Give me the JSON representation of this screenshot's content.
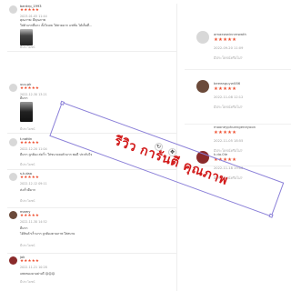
{
  "left_reviews": [
    {
      "user": "bankrp_1993",
      "stars": "★★★★★",
      "date": "2023-01-05 11:44",
      "lines": [
        "คุณภาพ: ดีคุณภาพ",
        "ใส่ตัวแรกที่แกะ ตั้งใจเลย ใส่สวยมาก แฟชั่น ได้เต็มที่..."
      ],
      "like": "มีประโยชน์"
    },
    {
      "user": "uuu.pk",
      "stars": "★★★★★",
      "date": "2022-12-30 13:21",
      "lines": [
        "ดีมาก"
      ],
      "like": "มีประโยชน์"
    },
    {
      "user": "t.nattin",
      "stars": "★★★★★",
      "date": "2022-12-20 11:04",
      "lines": [
        "ดีมาก ถูกต้อง ส่งเร็ว ใส่ขนาดลงตัวมาก พอดี ประทับใจ"
      ],
      "like": "มีประโยชน์"
    },
    {
      "user": "s.k.daa",
      "stars": "★★★★★",
      "date": "2022-12-12 09:11",
      "lines": [
        "ส่งเร็วดีมาก"
      ],
      "like": "มีประโยชน์"
    },
    {
      "user": "mamy",
      "stars": "★★★★★",
      "date": "2022-11-30 14:52",
      "lines": [
        "ดีมาก",
        "ได้สินค้าเร็วมาก ถูกต้องตามภาพ ใส่สบาย"
      ],
      "like": "มีประโยชน์"
    },
    {
      "user": "jok",
      "stars": "★★★★★",
      "date": "2022-11-21 10:28",
      "lines": [
        "แพคของมาอย่างดี 😊😊😊"
      ],
      "like": "มีประโยชน์"
    }
  ],
  "right_reviews": [
    {
      "user": "amaewwinnrewath",
      "stars": "★★★★★",
      "date": "2022-09-20 11:09",
      "like": "มีประโยชน์หรือไม่?"
    },
    {
      "user": "beeeaguyw086",
      "stars": "★★★★★",
      "date": "2022-11-08 12:12",
      "like": "มีประโยชน์หรือไม่?"
    },
    {
      "user": "mooneyphuengeneyoon",
      "stars": "★★★★★",
      "date": "2022-11-05 18:55",
      "like": "มีประโยชน์หรือไม่?"
    },
    {
      "user": "k.do.0le",
      "stars": "★★★★★",
      "date": "2022-11-18 19:08",
      "like": "มีประโยชน์หรือไม่?"
    }
  ],
  "overlay": {
    "text": "รีวิว การันตี คุณภาพ",
    "rotate_icon": "↻",
    "move_icon": "✥"
  }
}
